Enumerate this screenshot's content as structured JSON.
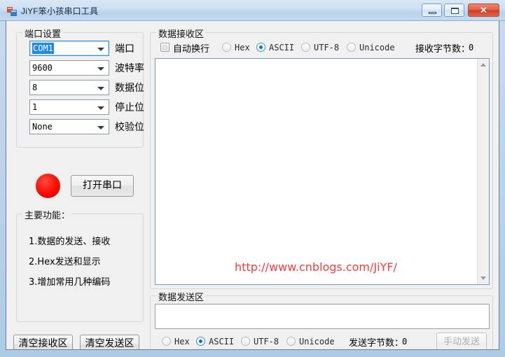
{
  "window": {
    "title": "JiYF笨小孩串口工具",
    "icon": "app-form-icon",
    "buttons": {
      "minimize": "minimize-icon",
      "maximize": "maximize-icon",
      "close": "✕"
    }
  },
  "port_settings": {
    "group_title": "端口设置",
    "rows": [
      {
        "value": "COM1",
        "label": "端口",
        "selected": true
      },
      {
        "value": "9600",
        "label": "波特率",
        "selected": false
      },
      {
        "value": "8",
        "label": "数据位",
        "selected": false
      },
      {
        "value": "1",
        "label": "停止位",
        "selected": false
      },
      {
        "value": "None",
        "label": "校验位",
        "selected": false
      }
    ],
    "led_color": "#fa0a00",
    "open_button": "打开串口"
  },
  "main_features": {
    "group_title": "主要功能：",
    "items": [
      "1.数据的发送、接收",
      "2.Hex发送和显示",
      "3.增加常用几种编码"
    ]
  },
  "bottom_buttons": {
    "clear_receive": "清空接收区",
    "clear_send": "清空发送区"
  },
  "receive_area": {
    "group_title": "数据接收区",
    "auto_wrap_label": "自动换行",
    "auto_wrap_checked": false,
    "encodings": [
      "Hex",
      "ASCII",
      "UTF-8",
      "Unicode"
    ],
    "encoding_selected": "ASCII",
    "byte_count_label": "接收字节数：",
    "byte_count_value": "0",
    "content": "",
    "watermark": "http://www.cnblogs.com/JiYF/",
    "watermark_color": "#fb3b3b"
  },
  "send_area": {
    "group_title": "数据发送区",
    "content": "",
    "encodings": [
      "Hex",
      "ASCII",
      "UTF-8",
      "Unicode"
    ],
    "encoding_selected": "ASCII",
    "byte_count_label": "发送字节数：",
    "byte_count_value": "0",
    "manual_send_button": "手动发送",
    "manual_send_enabled": false
  }
}
